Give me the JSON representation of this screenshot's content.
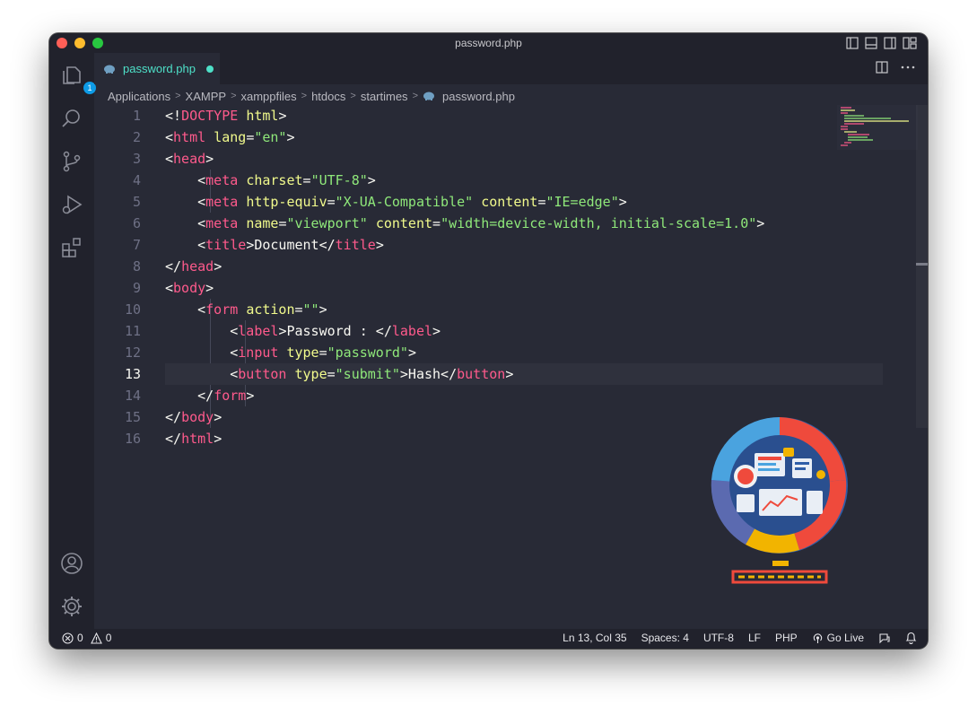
{
  "window": {
    "title": "password.php"
  },
  "activity_bar": {
    "explorer_badge": "1"
  },
  "tab": {
    "label": "password.php"
  },
  "breadcrumb": [
    "Applications",
    "XAMPP",
    "xamppfiles",
    "htdocs",
    "startimes",
    "password.php"
  ],
  "editor": {
    "line_numbers": [
      "1",
      "2",
      "3",
      "4",
      "5",
      "6",
      "7",
      "8",
      "9",
      "10",
      "11",
      "12",
      "13",
      "14",
      "15",
      "16"
    ],
    "active_line": 13,
    "lines": [
      [
        [
          "p",
          "<!"
        ],
        [
          "t",
          "DOCTYPE"
        ],
        [
          "p",
          " "
        ],
        [
          "a",
          "html"
        ],
        [
          "p",
          ">"
        ]
      ],
      [
        [
          "p",
          "<"
        ],
        [
          "t",
          "html"
        ],
        [
          "p",
          " "
        ],
        [
          "a",
          "lang"
        ],
        [
          "p",
          "="
        ],
        [
          "s",
          "\"en\""
        ],
        [
          "p",
          ">"
        ]
      ],
      [
        [
          "p",
          "<"
        ],
        [
          "t",
          "head"
        ],
        [
          "p",
          ">"
        ]
      ],
      [
        [
          "p",
          "    <"
        ],
        [
          "t",
          "meta"
        ],
        [
          "p",
          " "
        ],
        [
          "a",
          "charset"
        ],
        [
          "p",
          "="
        ],
        [
          "s",
          "\"UTF-8\""
        ],
        [
          "p",
          ">"
        ]
      ],
      [
        [
          "p",
          "    <"
        ],
        [
          "t",
          "meta"
        ],
        [
          "p",
          " "
        ],
        [
          "a",
          "http-equiv"
        ],
        [
          "p",
          "="
        ],
        [
          "s",
          "\"X-UA-Compatible\""
        ],
        [
          "p",
          " "
        ],
        [
          "a",
          "content"
        ],
        [
          "p",
          "="
        ],
        [
          "s",
          "\"IE=edge\""
        ],
        [
          "p",
          ">"
        ]
      ],
      [
        [
          "p",
          "    <"
        ],
        [
          "t",
          "meta"
        ],
        [
          "p",
          " "
        ],
        [
          "a",
          "name"
        ],
        [
          "p",
          "="
        ],
        [
          "s",
          "\"viewport\""
        ],
        [
          "p",
          " "
        ],
        [
          "a",
          "content"
        ],
        [
          "p",
          "="
        ],
        [
          "s",
          "\"width=device-width, initial-scale=1.0\""
        ],
        [
          "p",
          ">"
        ]
      ],
      [
        [
          "p",
          "    <"
        ],
        [
          "t",
          "title"
        ],
        [
          "p",
          ">Document</"
        ],
        [
          "t",
          "title"
        ],
        [
          "p",
          ">"
        ]
      ],
      [
        [
          "p",
          "</"
        ],
        [
          "t",
          "head"
        ],
        [
          "p",
          ">"
        ]
      ],
      [
        [
          "p",
          "<"
        ],
        [
          "t",
          "body"
        ],
        [
          "p",
          ">"
        ]
      ],
      [
        [
          "p",
          "    <"
        ],
        [
          "t",
          "form"
        ],
        [
          "p",
          " "
        ],
        [
          "a",
          "action"
        ],
        [
          "p",
          "="
        ],
        [
          "s",
          "\"\""
        ],
        [
          "p",
          ">"
        ]
      ],
      [
        [
          "p",
          "        <"
        ],
        [
          "t",
          "label"
        ],
        [
          "p",
          ">Password : </"
        ],
        [
          "t",
          "label"
        ],
        [
          "p",
          ">"
        ]
      ],
      [
        [
          "p",
          "        <"
        ],
        [
          "t",
          "input"
        ],
        [
          "p",
          " "
        ],
        [
          "a",
          "type"
        ],
        [
          "p",
          "="
        ],
        [
          "s",
          "\"password\""
        ],
        [
          "p",
          ">"
        ]
      ],
      [
        [
          "p",
          "        <"
        ],
        [
          "t",
          "button"
        ],
        [
          "p",
          " "
        ],
        [
          "a",
          "type"
        ],
        [
          "p",
          "="
        ],
        [
          "s",
          "\"submit\""
        ],
        [
          "p",
          ">Hash</"
        ],
        [
          "t",
          "button"
        ],
        [
          "p",
          ">"
        ]
      ],
      [
        [
          "p",
          "    </"
        ],
        [
          "t",
          "form"
        ],
        [
          "p",
          ">"
        ]
      ],
      [
        [
          "p",
          "</"
        ],
        [
          "t",
          "body"
        ],
        [
          "p",
          ">"
        ]
      ],
      [
        [
          "p",
          "</"
        ],
        [
          "t",
          "html"
        ],
        [
          "p",
          ">"
        ]
      ]
    ]
  },
  "status_bar": {
    "errors": "0",
    "warnings": "0",
    "cursor": "Ln 13, Col 35",
    "spaces": "Spaces: 4",
    "encoding": "UTF-8",
    "eol": "LF",
    "language": "PHP",
    "go_live": "Go Live"
  },
  "colors": {
    "background": "#282a36",
    "tag": "#ff5a8c",
    "attribute": "#f1fa8c",
    "string": "#8fe87a",
    "tab_label": "#4ee0c8",
    "badge": "#0e9be6"
  }
}
